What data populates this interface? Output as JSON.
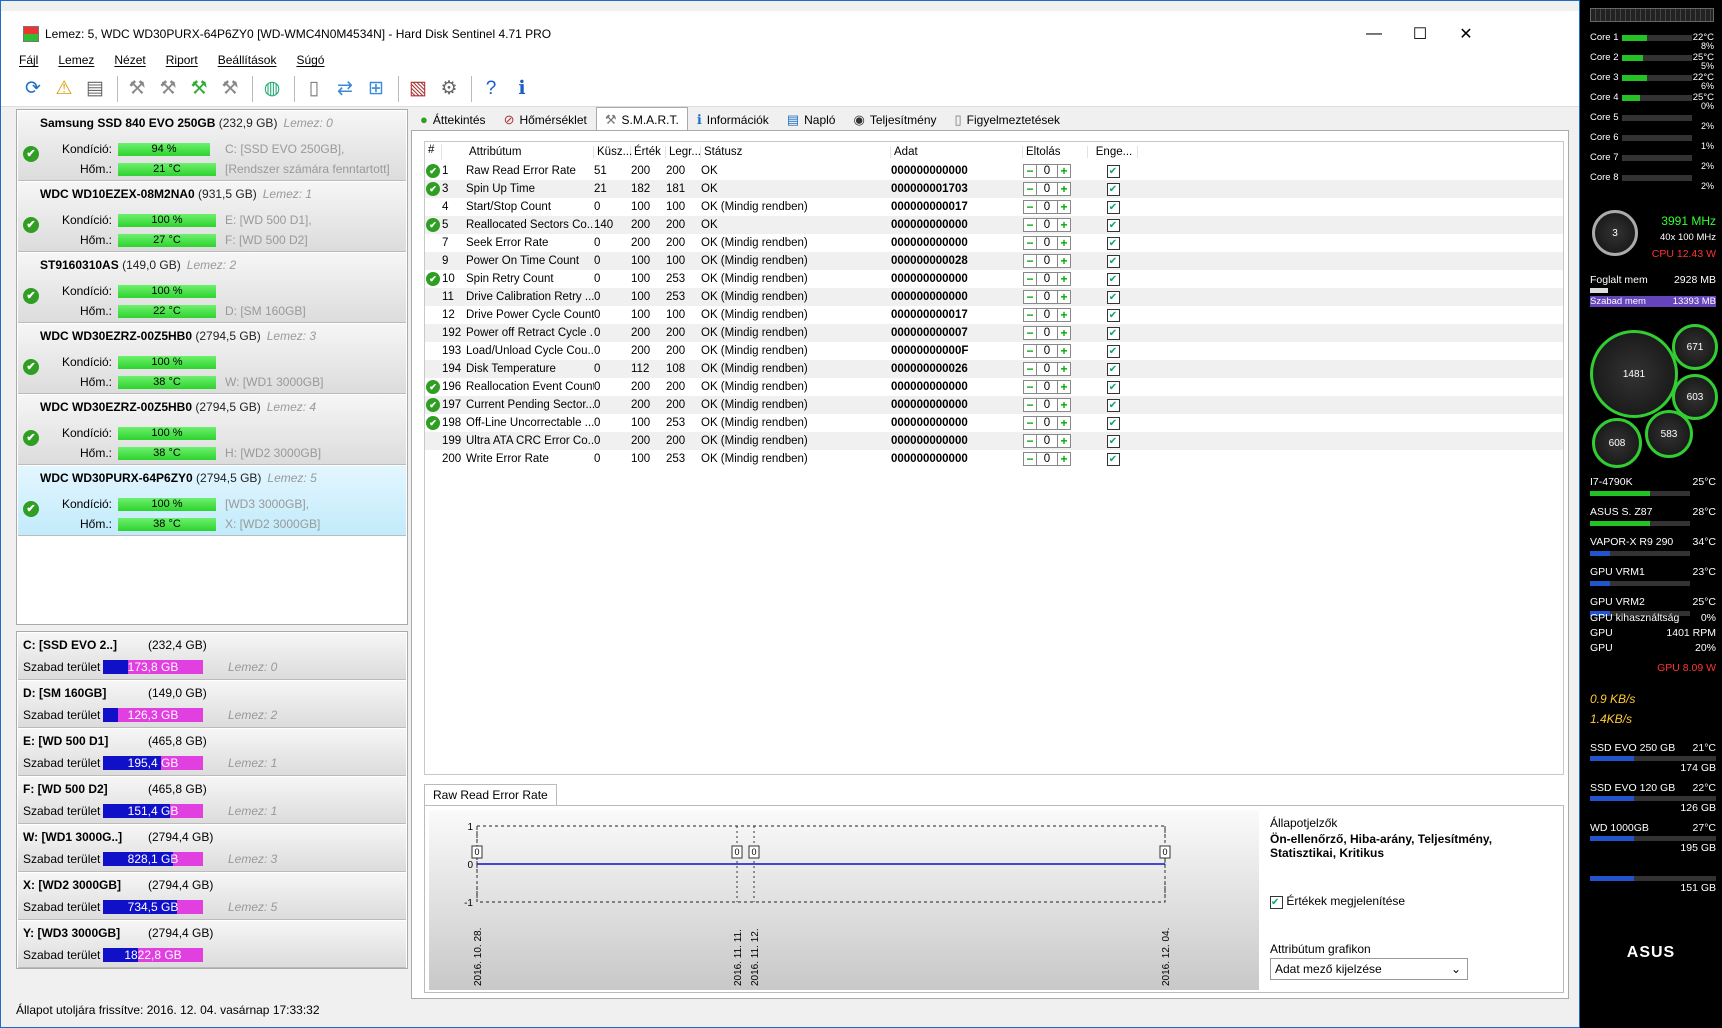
{
  "window": {
    "title": "Lemez: 5, WDC WD30PURX-64P6ZY0 [WD-WMC4N0M4534N]  -  Hard Disk Sentinel 4.71 PRO",
    "minimize": "—",
    "maximize": "☐",
    "close": "✕"
  },
  "menu": [
    "Fájl",
    "Lemez",
    "Nézet",
    "Riport",
    "Beállítások",
    "Súgó"
  ],
  "disks": [
    {
      "name": "Samsung SSD 840 EVO 250GB",
      "cap": "(232,9 GB)",
      "lemez": "Lemez: 0",
      "kond_label": "Kondíció:",
      "kond": "94 %",
      "kond_pct": 94,
      "hom_label": "Hőm.:",
      "hom": "21 °C",
      "info1": "C: [SSD EVO 250GB],",
      "info2": "[Rendszer számára fenntartott]"
    },
    {
      "name": "WDC WD10EZEX-08M2NA0",
      "cap": "(931,5 GB)",
      "lemez": "Lemez: 1",
      "kond_label": "Kondíció:",
      "kond": "100 %",
      "kond_pct": 100,
      "hom_label": "Hőm.:",
      "hom": "27 °C",
      "info1": "E: [WD 500 D1],",
      "info2": "F: [WD 500 D2]"
    },
    {
      "name": "ST9160310AS",
      "cap": "(149,0 GB)",
      "lemez": "Lemez: 2",
      "kond_label": "Kondíció:",
      "kond": "100 %",
      "kond_pct": 100,
      "hom_label": "Hőm.:",
      "hom": "22 °C",
      "info1": "",
      "info2": "D: [SM 160GB]"
    },
    {
      "name": "WDC WD30EZRZ-00Z5HB0",
      "cap": "(2794,5 GB)",
      "lemez": "Lemez: 3",
      "kond_label": "Kondíció:",
      "kond": "100 %",
      "kond_pct": 100,
      "hom_label": "Hőm.:",
      "hom": "38 °C",
      "info1": "",
      "info2": "W: [WD1 3000GB]"
    },
    {
      "name": "WDC WD30EZRZ-00Z5HB0",
      "cap": "(2794,5 GB)",
      "lemez": "Lemez: 4",
      "kond_label": "Kondíció:",
      "kond": "100 %",
      "kond_pct": 100,
      "hom_label": "Hőm.:",
      "hom": "38 °C",
      "info1": "",
      "info2": "H: [WD2 3000GB]"
    },
    {
      "name": "WDC WD30PURX-64P6ZY0",
      "cap": "(2794,5 GB)",
      "lemez": "Lemez: 5",
      "kond_label": "Kondíció:",
      "kond": "100 %",
      "kond_pct": 100,
      "hom_label": "Hőm.:",
      "hom": "38 °C",
      "info1": "[WD3 3000GB],",
      "info2": "X: [WD2 3000GB]"
    }
  ],
  "volumes": [
    {
      "name": "C: [SSD EVO 2..]",
      "size": "(232,4 GB)",
      "free_label": "Szabad terület",
      "free": "173,8 GB",
      "free_pct": 25,
      "lemez": "Lemez: 0"
    },
    {
      "name": "D: [SM 160GB]",
      "size": "(149,0 GB)",
      "free_label": "Szabad terület",
      "free": "126,3 GB",
      "free_pct": 15,
      "lemez": "Lemez: 2"
    },
    {
      "name": "E: [WD 500 D1]",
      "size": "(465,8 GB)",
      "free_label": "Szabad terület",
      "free": "195,4 GB",
      "free_pct": 58,
      "lemez": "Lemez: 1"
    },
    {
      "name": "F: [WD 500 D2]",
      "size": "(465,8 GB)",
      "free_label": "Szabad terület",
      "free": "151,4 GB",
      "free_pct": 67,
      "lemez": "Lemez: 1"
    },
    {
      "name": "W: [WD1 3000G..]",
      "size": "(2794,4 GB)",
      "free_label": "Szabad terület",
      "free": "828,1 GB",
      "free_pct": 70,
      "lemez": "Lemez: 3"
    },
    {
      "name": "X: [WD2 3000GB]",
      "size": "(2794,4 GB)",
      "free_label": "Szabad terület",
      "free": "734,5 GB",
      "free_pct": 74,
      "lemez": "Lemez: 5"
    },
    {
      "name": "Y: [WD3 3000GB]",
      "size": "(2794,4 GB)",
      "free_label": "Szabad terület",
      "free": "1822,8 GB",
      "free_pct": 35,
      "lemez": ""
    }
  ],
  "status": "Állapot utoljára frissítve: 2016. 12. 04. vasárnap 17:33:32",
  "tabs": [
    "Áttekintés",
    "Hőmérséklet",
    "S.M.A.R.T.",
    "Információk",
    "Napló",
    "Teljesítmény",
    "Figyelmeztetések"
  ],
  "smart": {
    "headers": [
      "#",
      "Attribútum",
      "Küsz...",
      "Érték",
      "Legr...",
      "Státusz",
      "Adat",
      "Eltolás",
      "Enge..."
    ],
    "rows": [
      [
        "1",
        "Raw Read Error Rate",
        "51",
        "200",
        "200",
        "OK",
        "000000000000",
        "0",
        true
      ],
      [
        "3",
        "Spin Up Time",
        "21",
        "182",
        "181",
        "OK",
        "000000001703",
        "0",
        true
      ],
      [
        "4",
        "Start/Stop Count",
        "0",
        "100",
        "100",
        "OK (Mindig rendben)",
        "000000000017",
        "0",
        false
      ],
      [
        "5",
        "Reallocated Sectors Co...",
        "140",
        "200",
        "200",
        "OK",
        "000000000000",
        "0",
        true
      ],
      [
        "7",
        "Seek Error Rate",
        "0",
        "200",
        "200",
        "OK (Mindig rendben)",
        "000000000000",
        "0",
        false
      ],
      [
        "9",
        "Power On Time Count",
        "0",
        "100",
        "100",
        "OK (Mindig rendben)",
        "000000000028",
        "0",
        false
      ],
      [
        "10",
        "Spin Retry Count",
        "0",
        "100",
        "253",
        "OK (Mindig rendben)",
        "000000000000",
        "0",
        true
      ],
      [
        "11",
        "Drive Calibration Retry ...",
        "0",
        "100",
        "253",
        "OK (Mindig rendben)",
        "000000000000",
        "0",
        false
      ],
      [
        "12",
        "Drive Power Cycle Count",
        "0",
        "100",
        "100",
        "OK (Mindig rendben)",
        "000000000017",
        "0",
        false
      ],
      [
        "192",
        "Power off Retract Cycle ...",
        "0",
        "200",
        "200",
        "OK (Mindig rendben)",
        "000000000007",
        "0",
        false
      ],
      [
        "193",
        "Load/Unload Cycle Cou...",
        "0",
        "200",
        "200",
        "OK (Mindig rendben)",
        "00000000000F",
        "0",
        false
      ],
      [
        "194",
        "Disk Temperature",
        "0",
        "112",
        "108",
        "OK (Mindig rendben)",
        "000000000026",
        "0",
        false
      ],
      [
        "196",
        "Reallocation Event Count",
        "0",
        "200",
        "200",
        "OK (Mindig rendben)",
        "000000000000",
        "0",
        true
      ],
      [
        "197",
        "Current Pending Sector...",
        "0",
        "200",
        "200",
        "OK (Mindig rendben)",
        "000000000000",
        "0",
        true
      ],
      [
        "198",
        "Off-Line Uncorrectable ...",
        "0",
        "100",
        "253",
        "OK (Mindig rendben)",
        "000000000000",
        "0",
        true
      ],
      [
        "199",
        "Ultra ATA CRC Error Co...",
        "0",
        "200",
        "200",
        "OK (Mindig rendben)",
        "000000000000",
        "0",
        false
      ],
      [
        "200",
        "Write Error Rate",
        "0",
        "100",
        "253",
        "OK (Mindig rendben)",
        "000000000000",
        "0",
        false
      ]
    ]
  },
  "graph": {
    "tab": "Raw Read Error Rate",
    "yticks": [
      "1",
      "0",
      "-1"
    ],
    "xlabels": [
      "2016. 10. 28.",
      "2016. 11. 11.",
      "2016. 11. 12.",
      "2016. 12. 04."
    ],
    "values": [
      0,
      0,
      0,
      0
    ],
    "side_h": "Állapotjelzők",
    "side_b": "Ön-ellenőrző, Hiba-arány, Teljesítmény, Statisztikai, Kritikus",
    "show_values": "Értékek megjelenítése",
    "attr_label": "Attribútum grafikon",
    "attr_select": "Adat mező kijelzése"
  },
  "sidebar": {
    "cores": [
      {
        "label": "Core 1",
        "temp": "22°C",
        "pct": "8%",
        "load": 35
      },
      {
        "label": "Core 2",
        "temp": "25°C",
        "pct": "5%",
        "load": 30
      },
      {
        "label": "Core 3",
        "temp": "22°C",
        "pct": "6%",
        "load": 35
      },
      {
        "label": "Core 4",
        "temp": "25°C",
        "pct": "0%",
        "load": 25
      },
      {
        "label": "Core 5",
        "temp": "",
        "pct": "2%",
        "load": 0
      },
      {
        "label": "Core 6",
        "temp": "",
        "pct": "1%",
        "load": 0
      },
      {
        "label": "Core 7",
        "temp": "",
        "pct": "2%",
        "load": 0
      },
      {
        "label": "Core 8",
        "temp": "",
        "pct": "2%",
        "load": 0
      }
    ],
    "cpu_gauge": "3",
    "mhz": "3991 MHz",
    "mult": "40x  100 MHz",
    "cpu_w": "CPU  12.43 W",
    "mem_used_label": "Foglalt mem",
    "mem_used": "2928 MB",
    "mem_free_label": "Szabad mem",
    "mem_free": "13393 MB",
    "fans": [
      "1481",
      "671",
      "603",
      "608",
      "583"
    ],
    "temps": [
      {
        "label": "I7-4790K",
        "val": "25°C"
      },
      {
        "label": "ASUS S. Z87",
        "val": "28°C"
      },
      {
        "label": "VAPOR-X R9 290",
        "val": "34°C"
      },
      {
        "label": "GPU VRM1",
        "val": "23°C"
      },
      {
        "label": "GPU VRM2",
        "val": "25°C"
      }
    ],
    "gpu_util_label": "GPU kihasználtság",
    "gpu_util": "0%",
    "gpu_fan_label": "GPU",
    "gpu_fan": "1401 RPM",
    "gpu2_label": "GPU",
    "gpu2": "20%",
    "gpu_w": "GPU 8.09 W",
    "net1": "0.9 KB/s",
    "net2": "1.4KB/s",
    "drives": [
      {
        "label": "SSD EVO 250 GB",
        "temp": "21°C",
        "size": "174 GB"
      },
      {
        "label": "SSD EVO 120 GB",
        "temp": "22°C",
        "size": "126 GB"
      },
      {
        "label": "WD 1000GB",
        "temp": "27°C",
        "size": "195 GB"
      },
      {
        "label": "",
        "temp": "",
        "size": "151 GB"
      }
    ],
    "brand": "ASUS"
  },
  "colors": {
    "ok_green": "#2f9e22",
    "accent": "#1c6ec4",
    "free_bar": "#1010c8",
    "used_bar": "#e040e0"
  }
}
